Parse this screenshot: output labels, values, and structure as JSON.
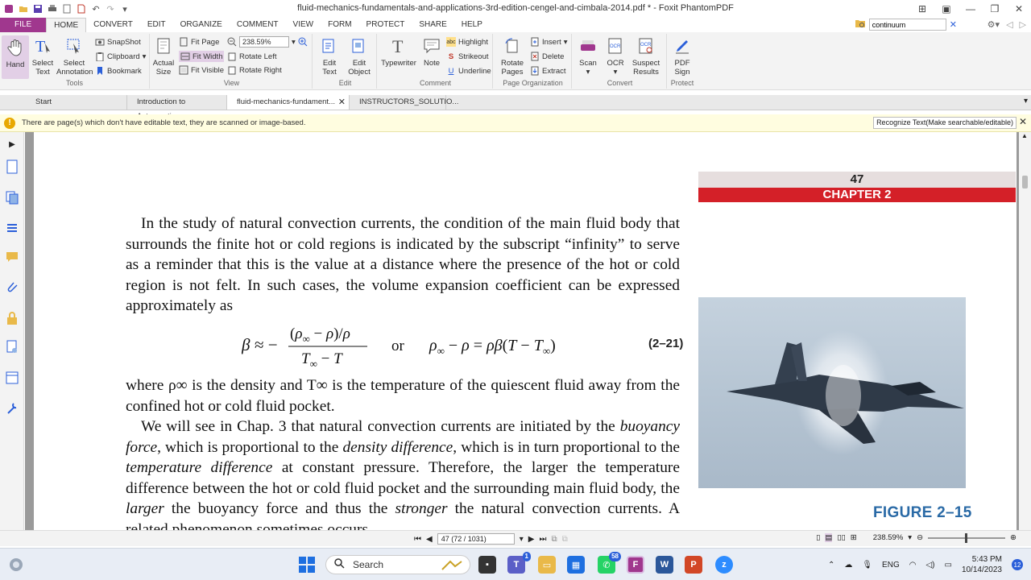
{
  "titlebar": {
    "title": "fluid-mechanics-fundamentals-and-applications-3rd-edition-cengel-and-cimbala-2014.pdf * - Foxit PhantomPDF"
  },
  "ribbon_tabs": [
    "FILE",
    "HOME",
    "CONVERT",
    "EDIT",
    "ORGANIZE",
    "COMMENT",
    "VIEW",
    "FORM",
    "PROTECT",
    "SHARE",
    "HELP"
  ],
  "search": {
    "value": "continuum"
  },
  "ribbon": {
    "tools": {
      "hand": "Hand",
      "select_text": "Select Text",
      "select_annotation": "Select Annotation",
      "snapshot": "SnapShot",
      "clipboard": "Clipboard",
      "bookmark": "Bookmark",
      "label": "Tools"
    },
    "view": {
      "actual_size": "Actual Size",
      "fit_page": "Fit Page",
      "fit_width": "Fit Width",
      "fit_visible": "Fit Visible",
      "zoom": "238.59%",
      "rotate_left": "Rotate Left",
      "rotate_right": "Rotate Right",
      "label": "View"
    },
    "edit": {
      "edit_text": "Edit Text",
      "edit_object": "Edit Object",
      "label": "Edit"
    },
    "comment": {
      "typewriter": "Typewriter",
      "note": "Note",
      "highlight": "Highlight",
      "strikeout": "Strikeout",
      "underline": "Underline",
      "label": "Comment"
    },
    "page_org": {
      "rotate_pages": "Rotate Pages",
      "insert": "Insert",
      "delete": "Delete",
      "extract": "Extract",
      "label": "Page Organization"
    },
    "convert": {
      "scan": "Scan",
      "ocr": "OCR",
      "suspect_results": "Suspect Results",
      "label": "Convert"
    },
    "protect": {
      "pdf_sign": "PDF Sign",
      "label": "Protect"
    }
  },
  "doc_tabs": [
    {
      "label": "Start"
    },
    {
      "label": "Introduction to Astronautics"
    },
    {
      "label": "fluid-mechanics-fundament..."
    },
    {
      "label": "INSTRUCTORS_SOLUTIO..."
    }
  ],
  "notification": {
    "message": "There are page(s) which don't have editable text, they are scanned or image-based.",
    "button": "Recognize Text(Make searchable/editable)"
  },
  "page": {
    "para1": "In the study of natural convection currents, the condition of the main fluid body that surrounds the finite hot or cold regions is indicated by the subscript “infinity” to serve as a reminder that this is the value at a distance where the presence of the hot or cold region is not felt. In such cases, the volume expansion coefficient can be expressed approximately as",
    "equation_number": "(2–21)",
    "eq_or": "or",
    "para2": "where ρ∞ is the density and T∞ is the temperature of the quiescent fluid away from the confined hot or cold fluid pocket.",
    "para3_a": "We will see in Chap. 3 that natural convection currents are initiated by the ",
    "para3_i1": "buoyancy force",
    "para3_b": ", which is proportional to the ",
    "para3_i2": "density difference",
    "para3_c": ", which is in turn proportional to the ",
    "para3_i3": "temperature difference",
    "para3_d": " at constant pressure. Therefore, the larger the temperature difference between the hot or cold fluid pocket and the surrounding main fluid body, the ",
    "para3_i4": "larger",
    "para3_e": " the buoyancy force and thus the ",
    "para3_i5": "stronger",
    "para3_f": " the natural convection currents. A related phenomenon sometimes occurs",
    "page_number": "47",
    "chapter": "CHAPTER 2",
    "figure_label": "FIGURE 2–15"
  },
  "statusbar": {
    "page_indicator": "47 (72 / 1031)",
    "zoom": "238.59%"
  },
  "taskbar": {
    "search_label": "Search",
    "teams_badge": "1",
    "whatsapp_badge": "58",
    "language": "ENG",
    "time": "5:43 PM",
    "date": "10/14/2023",
    "notifications": "12"
  }
}
